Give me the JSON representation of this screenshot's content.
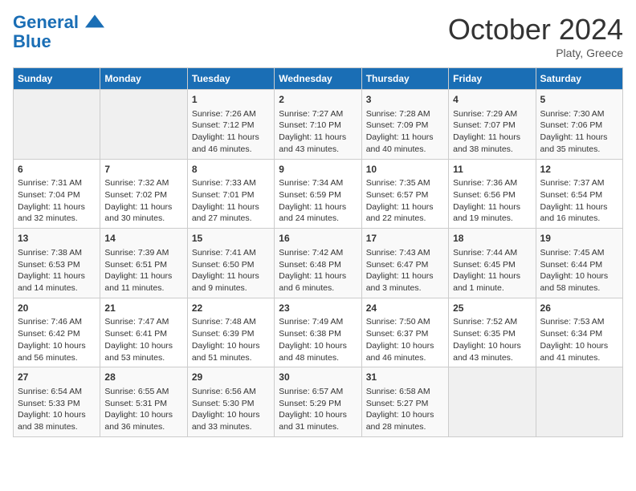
{
  "header": {
    "logo_line1": "General",
    "logo_line2": "Blue",
    "month_title": "October 2024",
    "location": "Platy, Greece"
  },
  "days_of_week": [
    "Sunday",
    "Monday",
    "Tuesday",
    "Wednesday",
    "Thursday",
    "Friday",
    "Saturday"
  ],
  "weeks": [
    [
      {
        "day": "",
        "info": ""
      },
      {
        "day": "",
        "info": ""
      },
      {
        "day": "1",
        "info": "Sunrise: 7:26 AM\nSunset: 7:12 PM\nDaylight: 11 hours and 46 minutes."
      },
      {
        "day": "2",
        "info": "Sunrise: 7:27 AM\nSunset: 7:10 PM\nDaylight: 11 hours and 43 minutes."
      },
      {
        "day": "3",
        "info": "Sunrise: 7:28 AM\nSunset: 7:09 PM\nDaylight: 11 hours and 40 minutes."
      },
      {
        "day": "4",
        "info": "Sunrise: 7:29 AM\nSunset: 7:07 PM\nDaylight: 11 hours and 38 minutes."
      },
      {
        "day": "5",
        "info": "Sunrise: 7:30 AM\nSunset: 7:06 PM\nDaylight: 11 hours and 35 minutes."
      }
    ],
    [
      {
        "day": "6",
        "info": "Sunrise: 7:31 AM\nSunset: 7:04 PM\nDaylight: 11 hours and 32 minutes."
      },
      {
        "day": "7",
        "info": "Sunrise: 7:32 AM\nSunset: 7:02 PM\nDaylight: 11 hours and 30 minutes."
      },
      {
        "day": "8",
        "info": "Sunrise: 7:33 AM\nSunset: 7:01 PM\nDaylight: 11 hours and 27 minutes."
      },
      {
        "day": "9",
        "info": "Sunrise: 7:34 AM\nSunset: 6:59 PM\nDaylight: 11 hours and 24 minutes."
      },
      {
        "day": "10",
        "info": "Sunrise: 7:35 AM\nSunset: 6:57 PM\nDaylight: 11 hours and 22 minutes."
      },
      {
        "day": "11",
        "info": "Sunrise: 7:36 AM\nSunset: 6:56 PM\nDaylight: 11 hours and 19 minutes."
      },
      {
        "day": "12",
        "info": "Sunrise: 7:37 AM\nSunset: 6:54 PM\nDaylight: 11 hours and 16 minutes."
      }
    ],
    [
      {
        "day": "13",
        "info": "Sunrise: 7:38 AM\nSunset: 6:53 PM\nDaylight: 11 hours and 14 minutes."
      },
      {
        "day": "14",
        "info": "Sunrise: 7:39 AM\nSunset: 6:51 PM\nDaylight: 11 hours and 11 minutes."
      },
      {
        "day": "15",
        "info": "Sunrise: 7:41 AM\nSunset: 6:50 PM\nDaylight: 11 hours and 9 minutes."
      },
      {
        "day": "16",
        "info": "Sunrise: 7:42 AM\nSunset: 6:48 PM\nDaylight: 11 hours and 6 minutes."
      },
      {
        "day": "17",
        "info": "Sunrise: 7:43 AM\nSunset: 6:47 PM\nDaylight: 11 hours and 3 minutes."
      },
      {
        "day": "18",
        "info": "Sunrise: 7:44 AM\nSunset: 6:45 PM\nDaylight: 11 hours and 1 minute."
      },
      {
        "day": "19",
        "info": "Sunrise: 7:45 AM\nSunset: 6:44 PM\nDaylight: 10 hours and 58 minutes."
      }
    ],
    [
      {
        "day": "20",
        "info": "Sunrise: 7:46 AM\nSunset: 6:42 PM\nDaylight: 10 hours and 56 minutes."
      },
      {
        "day": "21",
        "info": "Sunrise: 7:47 AM\nSunset: 6:41 PM\nDaylight: 10 hours and 53 minutes."
      },
      {
        "day": "22",
        "info": "Sunrise: 7:48 AM\nSunset: 6:39 PM\nDaylight: 10 hours and 51 minutes."
      },
      {
        "day": "23",
        "info": "Sunrise: 7:49 AM\nSunset: 6:38 PM\nDaylight: 10 hours and 48 minutes."
      },
      {
        "day": "24",
        "info": "Sunrise: 7:50 AM\nSunset: 6:37 PM\nDaylight: 10 hours and 46 minutes."
      },
      {
        "day": "25",
        "info": "Sunrise: 7:52 AM\nSunset: 6:35 PM\nDaylight: 10 hours and 43 minutes."
      },
      {
        "day": "26",
        "info": "Sunrise: 7:53 AM\nSunset: 6:34 PM\nDaylight: 10 hours and 41 minutes."
      }
    ],
    [
      {
        "day": "27",
        "info": "Sunrise: 6:54 AM\nSunset: 5:33 PM\nDaylight: 10 hours and 38 minutes."
      },
      {
        "day": "28",
        "info": "Sunrise: 6:55 AM\nSunset: 5:31 PM\nDaylight: 10 hours and 36 minutes."
      },
      {
        "day": "29",
        "info": "Sunrise: 6:56 AM\nSunset: 5:30 PM\nDaylight: 10 hours and 33 minutes."
      },
      {
        "day": "30",
        "info": "Sunrise: 6:57 AM\nSunset: 5:29 PM\nDaylight: 10 hours and 31 minutes."
      },
      {
        "day": "31",
        "info": "Sunrise: 6:58 AM\nSunset: 5:27 PM\nDaylight: 10 hours and 28 minutes."
      },
      {
        "day": "",
        "info": ""
      },
      {
        "day": "",
        "info": ""
      }
    ]
  ]
}
